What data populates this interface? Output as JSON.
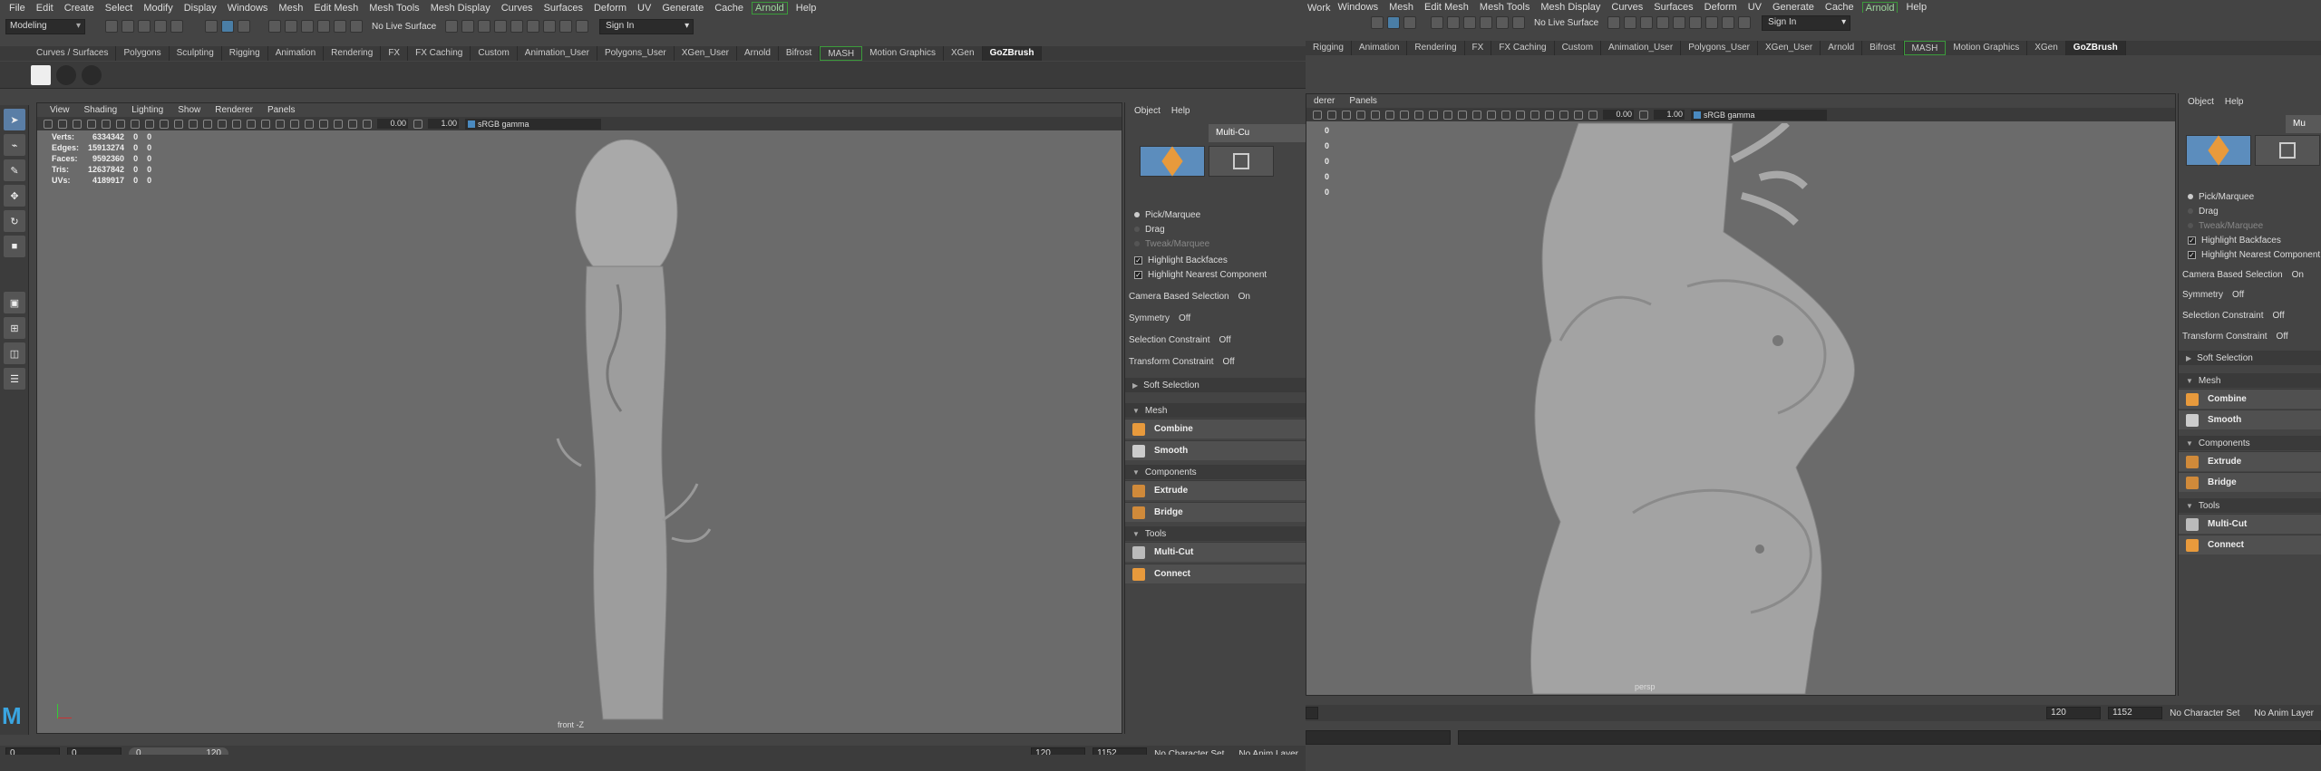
{
  "left": {
    "menus": [
      "File",
      "Edit",
      "Create",
      "Select",
      "Modify",
      "Display",
      "Windows",
      "Mesh",
      "Edit Mesh",
      "Mesh Tools",
      "Mesh Display",
      "Curves",
      "Surfaces",
      "Deform",
      "UV",
      "Generate",
      "Cache",
      "Arnold",
      "Help"
    ],
    "mode": "Modeling",
    "live_surface": "No Live Surface",
    "sign_in": "Sign In",
    "shelf_tabs": [
      "Curves / Surfaces",
      "Polygons",
      "Sculpting",
      "Rigging",
      "Animation",
      "Rendering",
      "FX",
      "FX Caching",
      "Custom",
      "Animation_User",
      "Polygons_User",
      "XGen_User",
      "Arnold",
      "Bifrost",
      "MASH",
      "Motion Graphics",
      "XGen",
      "GoZBrush"
    ],
    "viewport_menus": [
      "View",
      "Shading",
      "Lighting",
      "Show",
      "Renderer",
      "Panels"
    ],
    "exposure": "0.00",
    "gamma": "1.00",
    "colorspace": "sRGB gamma",
    "hud": [
      [
        "Verts:",
        "6334342",
        "0",
        "0"
      ],
      [
        "Edges:",
        "15913274",
        "0",
        "0"
      ],
      [
        "Faces:",
        "9592360",
        "0",
        "0"
      ],
      [
        "Tris:",
        "12637842",
        "0",
        "0"
      ],
      [
        "UVs:",
        "4189917",
        "0",
        "0"
      ]
    ],
    "camera": "front -Z",
    "attr": {
      "menu": [
        "Object",
        "Help"
      ],
      "title": "Multi-Cu",
      "pick": "Pick/Marquee",
      "drag": "Drag",
      "tweak": "Tweak/Marquee",
      "hb": "Highlight Backfaces",
      "hn": "Highlight Nearest Component",
      "cbs": "Camera Based Selection",
      "cbs_v": "On",
      "sym": "Symmetry",
      "sym_v": "Off",
      "sc": "Selection Constraint",
      "sc_v": "Off",
      "tc": "Transform Constraint",
      "tc_v": "Off",
      "soft": "Soft Selection",
      "mesh": "Mesh",
      "combine": "Combine",
      "smooth": "Smooth",
      "components": "Components",
      "extrude": "Extrude",
      "bridge": "Bridge",
      "tools": "Tools",
      "multicut": "Multi-Cut",
      "connect": "Connect"
    },
    "timeline": {
      "start": "0",
      "cur": "0",
      "range_start": "0",
      "range_end": "120",
      "end": "120",
      "end2": "1152",
      "char": "No Character Set",
      "anim": "No Anim Layer"
    }
  },
  "right": {
    "menus": [
      "Windows",
      "Mesh",
      "Edit Mesh",
      "Mesh Tools",
      "Mesh Display",
      "Curves",
      "Surfaces",
      "Deform",
      "UV",
      "Generate",
      "Cache",
      "Arnold",
      "Help"
    ],
    "work": "Work",
    "live_surface": "No Live Surface",
    "sign_in": "Sign In",
    "shelf_tabs": [
      "Rigging",
      "Animation",
      "Rendering",
      "FX",
      "FX Caching",
      "Custom",
      "Animation_User",
      "Polygons_User",
      "XGen_User",
      "Arnold",
      "Bifrost",
      "MASH",
      "Motion Graphics",
      "XGen",
      "GoZBrush"
    ],
    "viewport_menus": [
      "derer",
      "Panels"
    ],
    "exposure": "0.00",
    "gamma": "1.00",
    "colorspace": "sRGB gamma",
    "hud": [
      "0",
      "0",
      "0",
      "0",
      "0"
    ],
    "camera": "persp",
    "attr": {
      "menu": [
        "Object",
        "Help"
      ],
      "title": "Mu",
      "pick": "Pick/Marquee",
      "drag": "Drag",
      "tweak": "Tweak/Marquee",
      "hb": "Highlight Backfaces",
      "hn": "Highlight Nearest Component",
      "cbs": "Camera Based Selection",
      "cbs_v": "On",
      "sym": "Symmetry",
      "sym_v": "Off",
      "sc": "Selection Constraint",
      "sc_v": "Off",
      "tc": "Transform Constraint",
      "tc_v": "Off",
      "soft": "Soft Selection",
      "mesh": "Mesh",
      "combine": "Combine",
      "smooth": "Smooth",
      "components": "Components",
      "extrude": "Extrude",
      "bridge": "Bridge",
      "tools": "Tools",
      "multicut": "Multi-Cut",
      "connect": "Connect"
    },
    "timeline": {
      "end": "120",
      "end2": "1152",
      "char": "No Character Set",
      "anim": "No Anim Layer"
    }
  },
  "colors": {
    "accent": "#5c8dbd",
    "arnold": "#3b9b3b",
    "viewport": "#6b6b6b"
  }
}
